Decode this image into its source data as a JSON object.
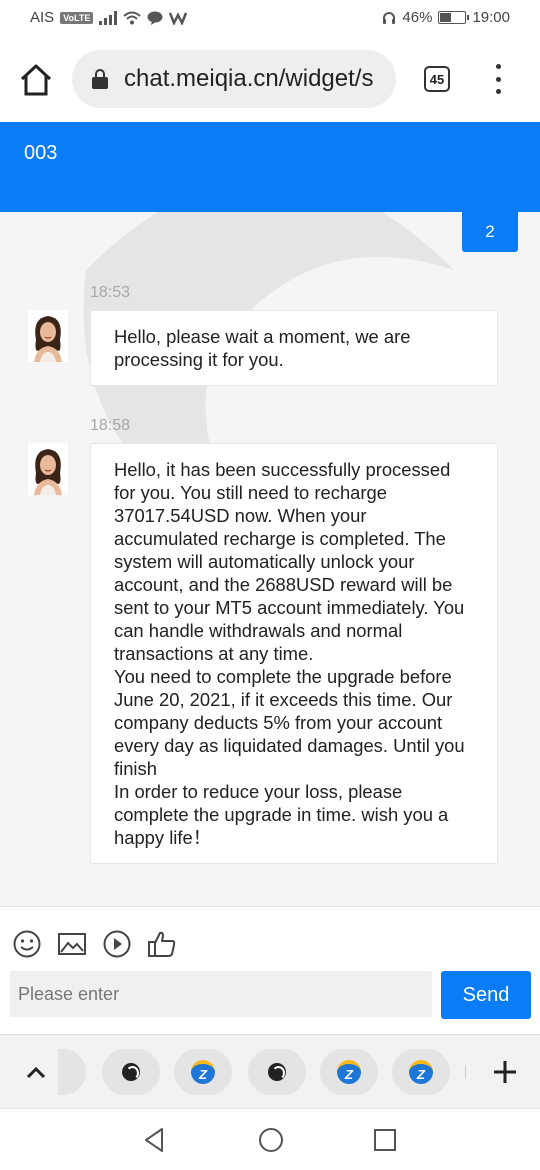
{
  "status_bar": {
    "carrier": "AIS",
    "volte": "VoLTE",
    "battery": "46%",
    "battery_level": 0.46,
    "time": "19:00"
  },
  "browser": {
    "url": "chat.meiqia.cn/widget/s",
    "tab_count": "45"
  },
  "chat": {
    "title": "003",
    "my_message": "2",
    "messages": [
      {
        "time": "18:53",
        "text": "Hello, please wait a moment, we are processing it for you."
      },
      {
        "time": "18:58",
        "text": "Hello, it has been successfully processed for you. You still need to recharge 37017.54USD now. When your accumulated recharge is completed. The system will automatically unlock your account, and the 2688USD reward will be sent to your MT5 account immediately. You can handle withdrawals and normal transactions at any time.\nYou need to complete the upgrade before June 20, 2021, if it exceeds this time. Our company deducts 5% from your account every day as liquidated damages. Until you finish\nIn order to reduce your loss, please complete the upgrade in time. wish you a happy life！"
      }
    ]
  },
  "composer": {
    "placeholder": "Please enter",
    "send_label": "Send",
    "tools": [
      "emoji-icon",
      "image-icon",
      "play-icon",
      "thumbs-up-icon"
    ]
  },
  "tab_strip": {
    "tabs": [
      "globe-icon",
      "zalo-logo-icon",
      "globe-icon",
      "zalo-logo-icon",
      "zalo-logo-icon"
    ],
    "zalo_letter": "Z"
  },
  "colors": {
    "brand_blue": "#0a7cf5"
  }
}
